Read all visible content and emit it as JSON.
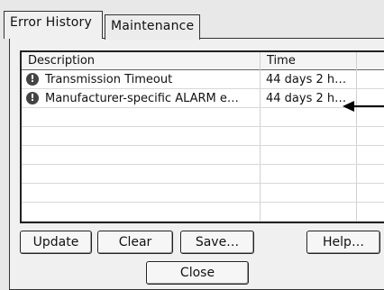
{
  "tabs": [
    {
      "label": "Error History",
      "active": true
    },
    {
      "label": "Maintenance",
      "active": false
    }
  ],
  "table": {
    "columns": [
      "Description",
      "Time"
    ],
    "rows": [
      {
        "icon": "alarm-icon",
        "description": "Transmission Timeout",
        "time": "44 days 2 h…"
      },
      {
        "icon": "alarm-icon",
        "description": "Manufacturer-specific ALARM e…",
        "time": "44 days 2 h…"
      }
    ]
  },
  "buttons": {
    "update": "Update",
    "clear": "Clear",
    "save": "Save…",
    "help": "Help…",
    "close": "Close"
  }
}
